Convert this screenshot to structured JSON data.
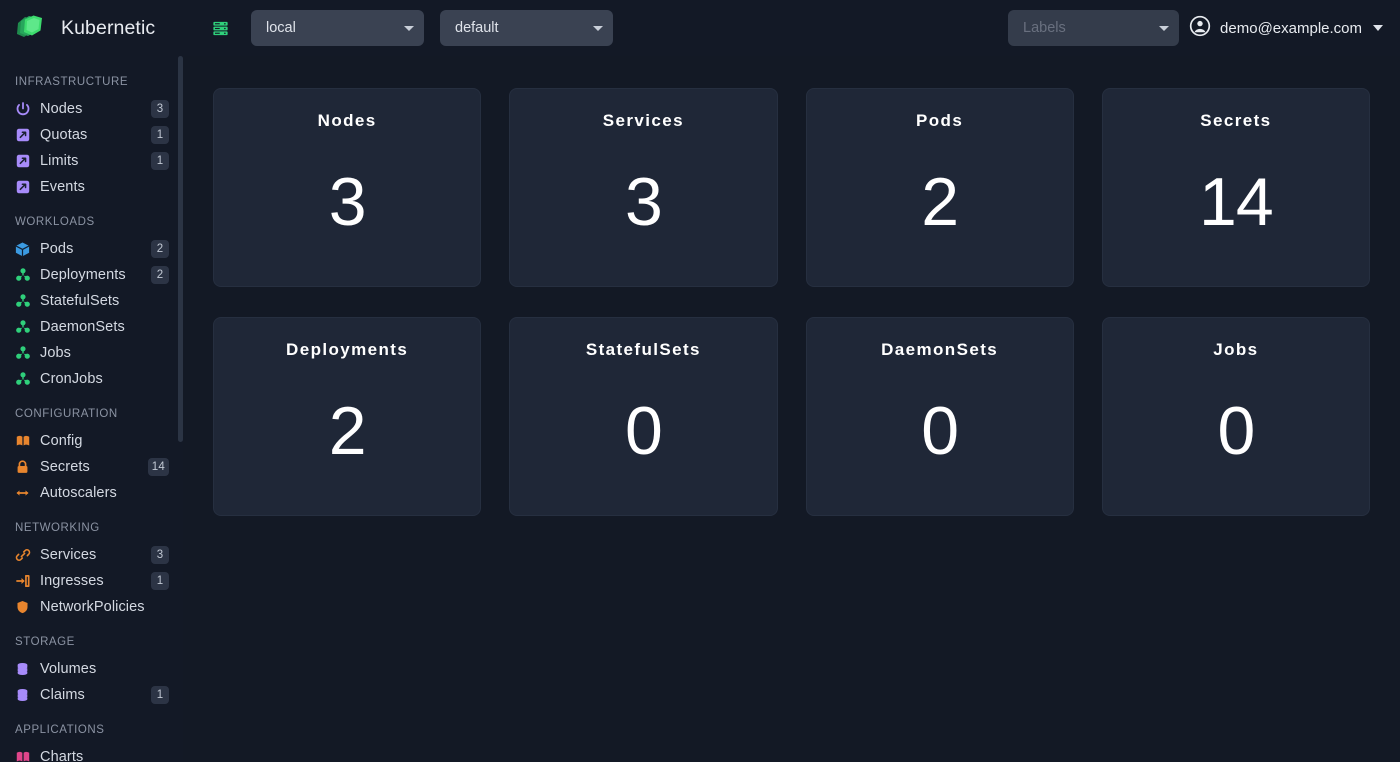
{
  "header": {
    "brand": "Kubernetic",
    "logo_icon": "kubernetic-layers-logo",
    "cluster_icon": "server-stack-icon",
    "cluster_select": {
      "value": "local",
      "icon": "chevron-down-icon"
    },
    "namespace_select": {
      "value": "default",
      "icon": "chevron-down-icon"
    },
    "labels_select": {
      "placeholder": "Labels",
      "value": "",
      "icon": "chevron-down-icon"
    },
    "user": {
      "email": "demo@example.com",
      "avatar_icon": "user-circle-icon",
      "caret_icon": "chevron-down-icon"
    }
  },
  "sidebar": {
    "sections": [
      {
        "title": "INFRASTRUCTURE",
        "items": [
          {
            "label": "Nodes",
            "badge": "3",
            "icon": "power-icon",
            "color": "#a78bfa"
          },
          {
            "label": "Quotas",
            "badge": "1",
            "icon": "gauge-icon",
            "color": "#a78bfa"
          },
          {
            "label": "Limits",
            "badge": "1",
            "icon": "gauge-icon",
            "color": "#a78bfa"
          },
          {
            "label": "Events",
            "badge": "",
            "icon": "gauge-icon",
            "color": "#a78bfa"
          }
        ]
      },
      {
        "title": "WORKLOADS",
        "items": [
          {
            "label": "Pods",
            "badge": "2",
            "icon": "pod-cube-icon",
            "color": "#3b9ae1"
          },
          {
            "label": "Deployments",
            "badge": "2",
            "icon": "cluster-nodes-icon",
            "color": "#2fd07b"
          },
          {
            "label": "StatefulSets",
            "badge": "",
            "icon": "cluster-nodes-icon",
            "color": "#2fd07b"
          },
          {
            "label": "DaemonSets",
            "badge": "",
            "icon": "cluster-nodes-icon",
            "color": "#2fd07b"
          },
          {
            "label": "Jobs",
            "badge": "",
            "icon": "cluster-nodes-icon",
            "color": "#2fd07b"
          },
          {
            "label": "CronJobs",
            "badge": "",
            "icon": "cluster-nodes-icon",
            "color": "#2fd07b"
          }
        ]
      },
      {
        "title": "CONFIGURATION",
        "items": [
          {
            "label": "Config",
            "badge": "",
            "icon": "book-icon",
            "color": "#e8852e"
          },
          {
            "label": "Secrets",
            "badge": "14",
            "icon": "lock-icon",
            "color": "#e8852e"
          },
          {
            "label": "Autoscalers",
            "badge": "",
            "icon": "arrows-h-icon",
            "color": "#e8852e"
          }
        ]
      },
      {
        "title": "NETWORKING",
        "items": [
          {
            "label": "Services",
            "badge": "3",
            "icon": "link-icon",
            "color": "#e8852e"
          },
          {
            "label": "Ingresses",
            "badge": "1",
            "icon": "signin-icon",
            "color": "#e8852e"
          },
          {
            "label": "NetworkPolicies",
            "badge": "",
            "icon": "shield-icon",
            "color": "#e8852e"
          }
        ]
      },
      {
        "title": "STORAGE",
        "items": [
          {
            "label": "Volumes",
            "badge": "",
            "icon": "database-icon",
            "color": "#a78bfa"
          },
          {
            "label": "Claims",
            "badge": "1",
            "icon": "database-icon",
            "color": "#a78bfa"
          }
        ]
      },
      {
        "title": "APPLICATIONS",
        "items": [
          {
            "label": "Charts",
            "badge": "",
            "icon": "book-icon",
            "color": "#e0458a"
          }
        ]
      }
    ]
  },
  "main": {
    "cards": [
      {
        "title": "Nodes",
        "value": "3"
      },
      {
        "title": "Services",
        "value": "3"
      },
      {
        "title": "Pods",
        "value": "2"
      },
      {
        "title": "Secrets",
        "value": "14"
      },
      {
        "title": "Deployments",
        "value": "2"
      },
      {
        "title": "StatefulSets",
        "value": "0"
      },
      {
        "title": "DaemonSets",
        "value": "0"
      },
      {
        "title": "Jobs",
        "value": "0"
      }
    ]
  },
  "colors": {
    "background": "#131925",
    "panel": "#131926",
    "card": "#1f2737",
    "accent_green": "#2fd07b",
    "accent_orange": "#e8852e",
    "accent_purple": "#a78bfa",
    "accent_blue": "#3b9ae1",
    "accent_pink": "#e0458a"
  }
}
